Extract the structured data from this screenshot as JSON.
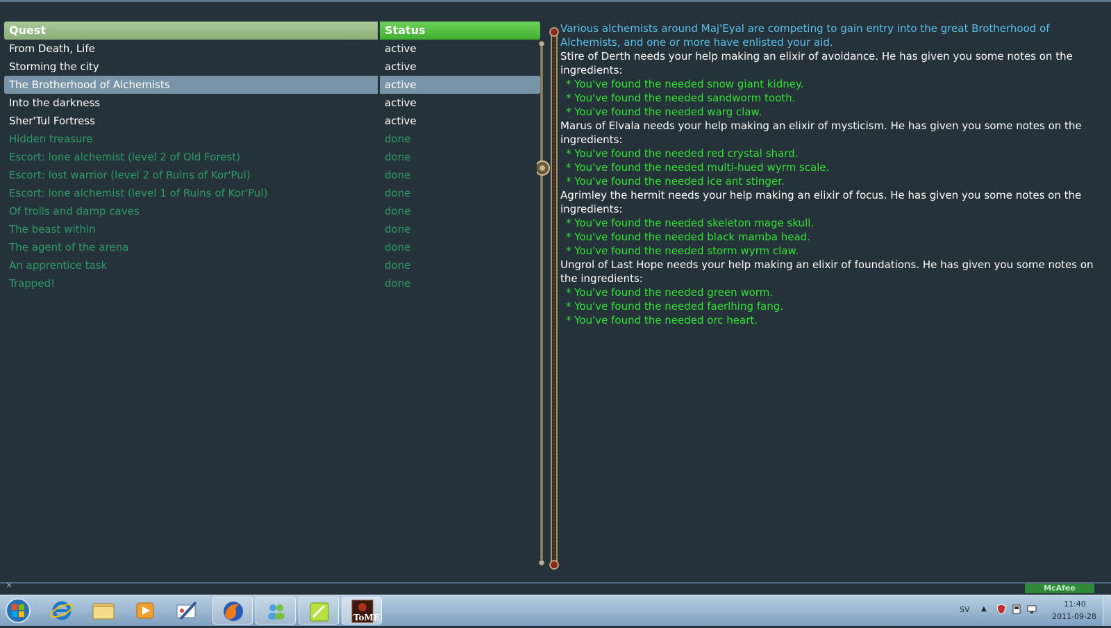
{
  "quest_log": {
    "columns": {
      "quest": "Quest",
      "status": "Status"
    },
    "rows": [
      {
        "name": "From Death, Life",
        "status": "active"
      },
      {
        "name": "Storming the city",
        "status": "active"
      },
      {
        "name": "The Brotherhood of Alchemists",
        "status": "active"
      },
      {
        "name": "Into the darkness",
        "status": "active"
      },
      {
        "name": "Sher'Tul Fortress",
        "status": "active"
      },
      {
        "name": "Hidden treasure",
        "status": "done"
      },
      {
        "name": "Escort: lone alchemist (level 2 of Old Forest)",
        "status": "done"
      },
      {
        "name": "Escort: lost warrior (level 2 of Ruins of Kor'Pul)",
        "status": "done"
      },
      {
        "name": "Escort: lone alchemist (level 1 of Ruins of Kor'Pul)",
        "status": "done"
      },
      {
        "name": "Of trolls and damp caves",
        "status": "done"
      },
      {
        "name": "The beast within",
        "status": "done"
      },
      {
        "name": "The agent of the arena",
        "status": "done"
      },
      {
        "name": "An apprentice task",
        "status": "done"
      },
      {
        "name": "Trapped!",
        "status": "done"
      }
    ],
    "selected_index": 2
  },
  "description": {
    "intro": "Various alchemists around Maj'Eyal are competing to gain entry into the great Brotherhood of Alchemists, and one or more have enlisted your aid.",
    "lines": [
      {
        "type": "line",
        "text": "Stire of Derth needs your help making an elixir of avoidance. He has given you some notes on the ingredients:"
      },
      {
        "type": "found",
        "text": "* You've found the needed snow giant kidney."
      },
      {
        "type": "found",
        "text": "* You've found the needed sandworm tooth."
      },
      {
        "type": "found",
        "text": "* You've found the needed warg claw."
      },
      {
        "type": "line",
        "text": "Marus of Elvala needs your help making an elixir of mysticism. He has given you some notes on the ingredients:"
      },
      {
        "type": "found",
        "text": "* You've found the needed red crystal shard."
      },
      {
        "type": "found",
        "text": "* You've found the needed multi-hued wyrm scale."
      },
      {
        "type": "found",
        "text": "* You've found the needed ice ant stinger."
      },
      {
        "type": "line",
        "text": "Agrimley the hermit needs your help making an elixir of focus. He has given you some notes on the ingredients:"
      },
      {
        "type": "found",
        "text": "* You've found the needed skeleton mage skull."
      },
      {
        "type": "found",
        "text": "* You've found the needed black mamba head."
      },
      {
        "type": "found",
        "text": "* You've found the needed storm wyrm claw."
      },
      {
        "type": "line",
        "text": "Ungrol of Last Hope needs your help making an elixir of foundations. He has given you some notes on the ingredients:"
      },
      {
        "type": "found",
        "text": "* You've found the needed green worm."
      },
      {
        "type": "found",
        "text": "* You've found the needed faerlhing fang."
      },
      {
        "type": "found",
        "text": "* You've found the needed orc heart."
      }
    ]
  },
  "tray": {
    "language": "SV",
    "time": "11:40",
    "date": "2011-09-28",
    "mcafee_label": "McAfee"
  },
  "taskbar": {
    "apps": [
      "start-orb-icon",
      "internet-explorer-icon",
      "file-explorer-icon",
      "media-player-icon",
      "paint-icon",
      "firefox-icon",
      "messenger-icon",
      "notes-icon",
      "tome-game-icon"
    ],
    "tome_label": "ToME"
  },
  "colors": {
    "background": "#25323a",
    "quest_header": "#9abb8a",
    "status_header": "#4fbf3f",
    "selected_row": "#7894a8",
    "active_text": "#ffffff",
    "done_text": "#2e9a66",
    "intro_text": "#5bc0ee",
    "found_text": "#33e233"
  }
}
